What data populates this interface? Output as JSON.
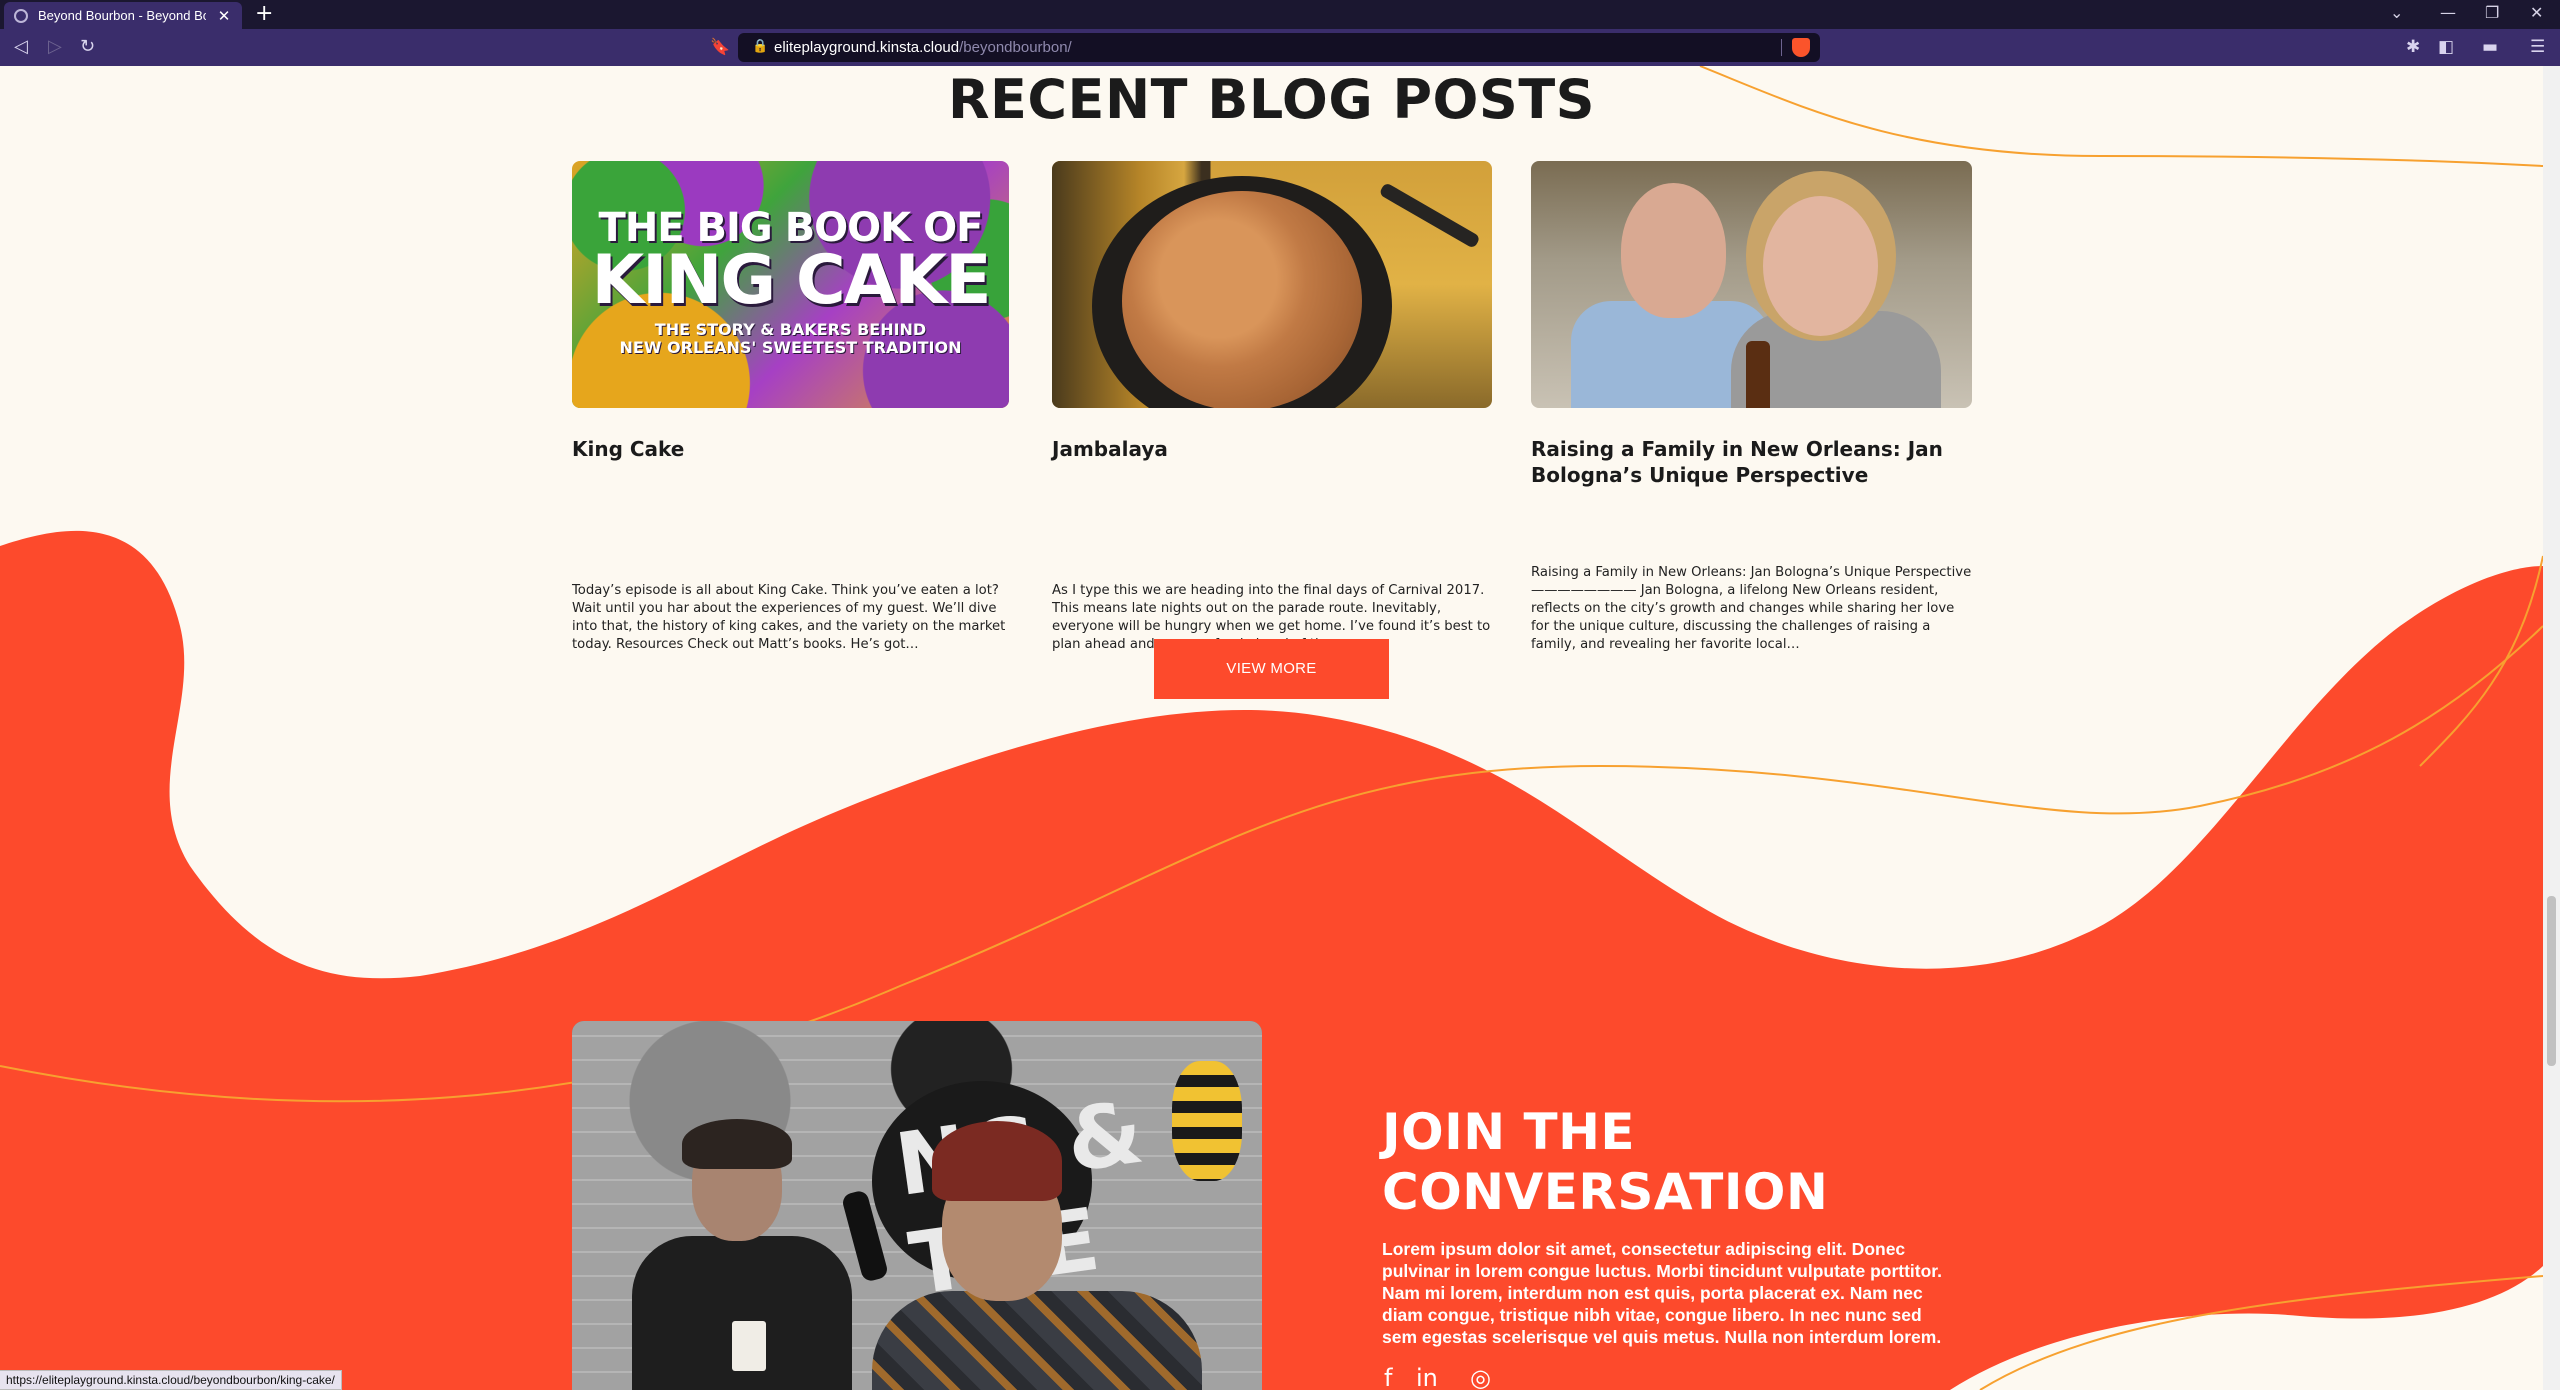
{
  "browser": {
    "tab_title": "Beyond Bourbon - Beyond Bourb",
    "url_host": "eliteplayground.kinsta.cloud",
    "url_path": "/beyondbourbon/",
    "status_url": "https://eliteplayground.kinsta.cloud/beyondbourbon/king-cake/"
  },
  "blog": {
    "heading": "RECENT BLOG POSTS",
    "posts": [
      {
        "title": "King Cake",
        "excerpt": "Today’s episode is all about King Cake. Think you’ve eaten a lot? Wait until you har about the experiences of my guest. We’ll dive into that, the history of king cakes, and the variety on the market today. Resources Check out Matt’s books. He’s got…",
        "image_lines": [
          "THE BIG BOOK OF",
          "KING CAKE",
          "THE STORY & BAKERS BEHIND",
          "NEW ORLEANS' SWEETEST TRADITION"
        ]
      },
      {
        "title": "Jambalaya",
        "excerpt": "As I type this we are heading into the final days of Carnival 2017. This means late nights out on the parade route. Inevitably, everyone will be hungry when we get home. I’ve found it’s best to plan ahead and prepare food ahead of time.…"
      },
      {
        "title": "Raising a Family in New Orleans: Jan Bologna’s Unique Perspective",
        "excerpt": "Raising a Family in New Orleans: Jan Bologna’s Unique Perspective ———————— Jan Bologna, a lifelong New Orleans resident, reflects on the city’s growth and changes while sharing her love for the unique culture, discussing the challenges of raising a family, and revealing her favorite local…"
      }
    ],
    "view_more": "VIEW MORE"
  },
  "join": {
    "title_line1": "JOIN THE",
    "title_line2": "CONVERSATION",
    "body": "Lorem ipsum dolor sit amet, consectetur adipiscing elit. Donec pulvinar in lorem congue luctus. Morbi tincidunt vulputate porttitor. Nam mi lorem, interdum non est quis, porta placerat ex. Nam nec diam congue, tristique nibh vitae, congue libero. In nec nunc sed sem egestas scelerisque vel quis metus. Nulla non interdum lorem.",
    "pod_sign": "NG & THE"
  },
  "colors": {
    "accent": "#fd4a2c",
    "cream": "#fdf9f1",
    "line": "#f7a130",
    "browser_bar": "#3a2d6b"
  },
  "icons": [
    "facebook-icon",
    "linkedin-icon",
    "instagram-icon"
  ]
}
